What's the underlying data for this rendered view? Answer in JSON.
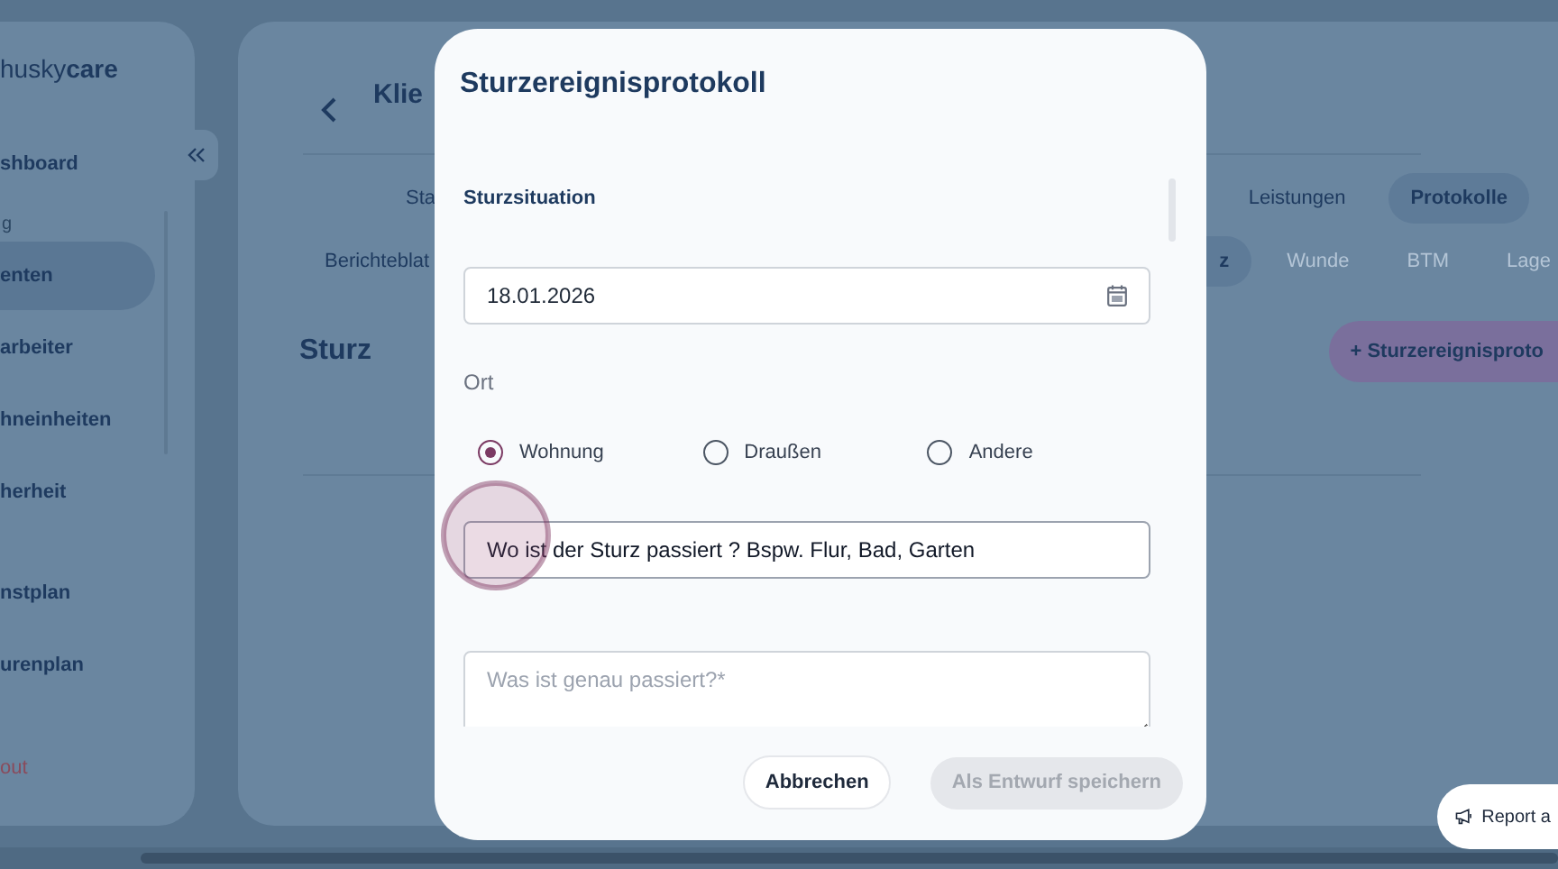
{
  "sidebar": {
    "logo": "husky**care**",
    "items": [
      {
        "label": "shboard",
        "selected": false
      },
      {
        "section": "g"
      },
      {
        "label": "enten",
        "selected": true
      },
      {
        "label": "arbeiter",
        "selected": false
      },
      {
        "label": "hneinheiten",
        "selected": false
      },
      {
        "label": "herheit",
        "selected": false
      },
      {
        "label": "nstplan",
        "selected": false
      },
      {
        "label": "urenplan",
        "selected": false
      }
    ],
    "logout": "out"
  },
  "main": {
    "title": "Klie",
    "tabs": [
      {
        "label": "Sta",
        "selected": false
      },
      {
        "label": "Leistungen",
        "selected": false
      },
      {
        "label": "Protokolle",
        "selected": true
      }
    ],
    "subtabs": [
      {
        "label": "Berichteblat",
        "selected": false
      },
      {
        "label": "z",
        "selected": true
      },
      {
        "label": "Wunde",
        "selected": false
      },
      {
        "label": "BTM",
        "selected": false
      },
      {
        "label": "Lage",
        "selected": false
      }
    ],
    "heading": "Sturz",
    "add_button": "+ Sturzereignisproto"
  },
  "dialog": {
    "title": "Sturzereignisprotokoll",
    "section": "Sturzsituation",
    "date": "18.01.2026",
    "ort_label": "Ort",
    "ort_options": [
      {
        "label": "Wohnung",
        "selected": true
      },
      {
        "label": "Draußen",
        "selected": false
      },
      {
        "label": "Andere",
        "selected": false
      }
    ],
    "location_value": "Wo ist der Sturz passiert ? Bspw. Flur, Bad, Garten",
    "details_placeholder": "Was ist genau passiert?*",
    "cancel": "Abbrechen",
    "save_draft": {
      "label": "Als Entwurf speichern",
      "disabled": true
    }
  },
  "report_button": "Report a"
}
